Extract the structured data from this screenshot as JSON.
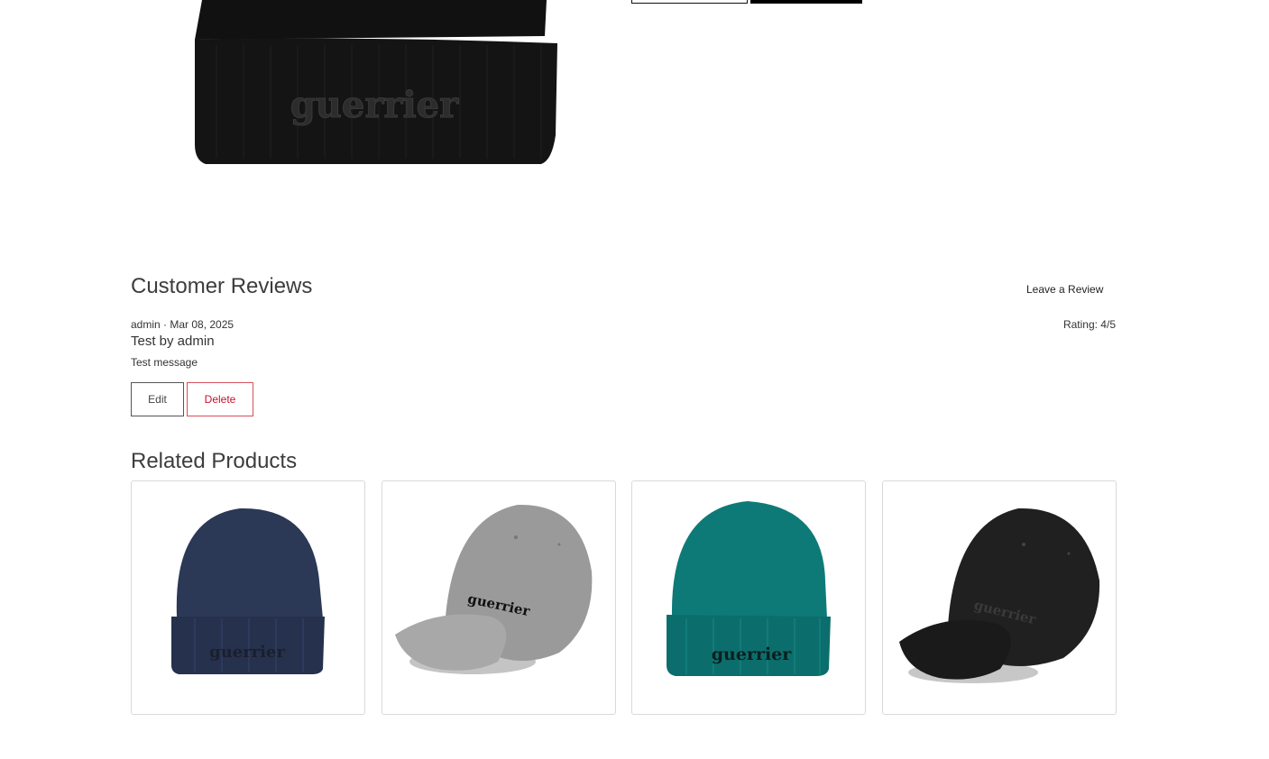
{
  "product": {
    "hero_image": "black-beanie-image",
    "logo_text": "guerrier"
  },
  "reviews": {
    "title": "Customer Reviews",
    "leave_review_label": "Leave a Review",
    "items": [
      {
        "meta": "admin · Mar 08, 2025",
        "rating": "Rating: 4/5",
        "title": "Test by admin",
        "body": "Test message",
        "edit_label": "Edit",
        "delete_label": "Delete"
      }
    ]
  },
  "related": {
    "title": "Related Products",
    "items": [
      {
        "image": "navy-beanie-image",
        "logo_text": "guerrier",
        "color": "#2b3856"
      },
      {
        "image": "grey-cap-image",
        "logo_text": "guerrier",
        "color": "#9a9a9a"
      },
      {
        "image": "teal-beanie-image",
        "logo_text": "guerrier",
        "color": "#0e7a78"
      },
      {
        "image": "black-cap-image",
        "logo_text": "guerrier",
        "color": "#202020"
      }
    ]
  },
  "colors": {
    "delete": "#c8102e",
    "heading": "#3d3d3d"
  }
}
